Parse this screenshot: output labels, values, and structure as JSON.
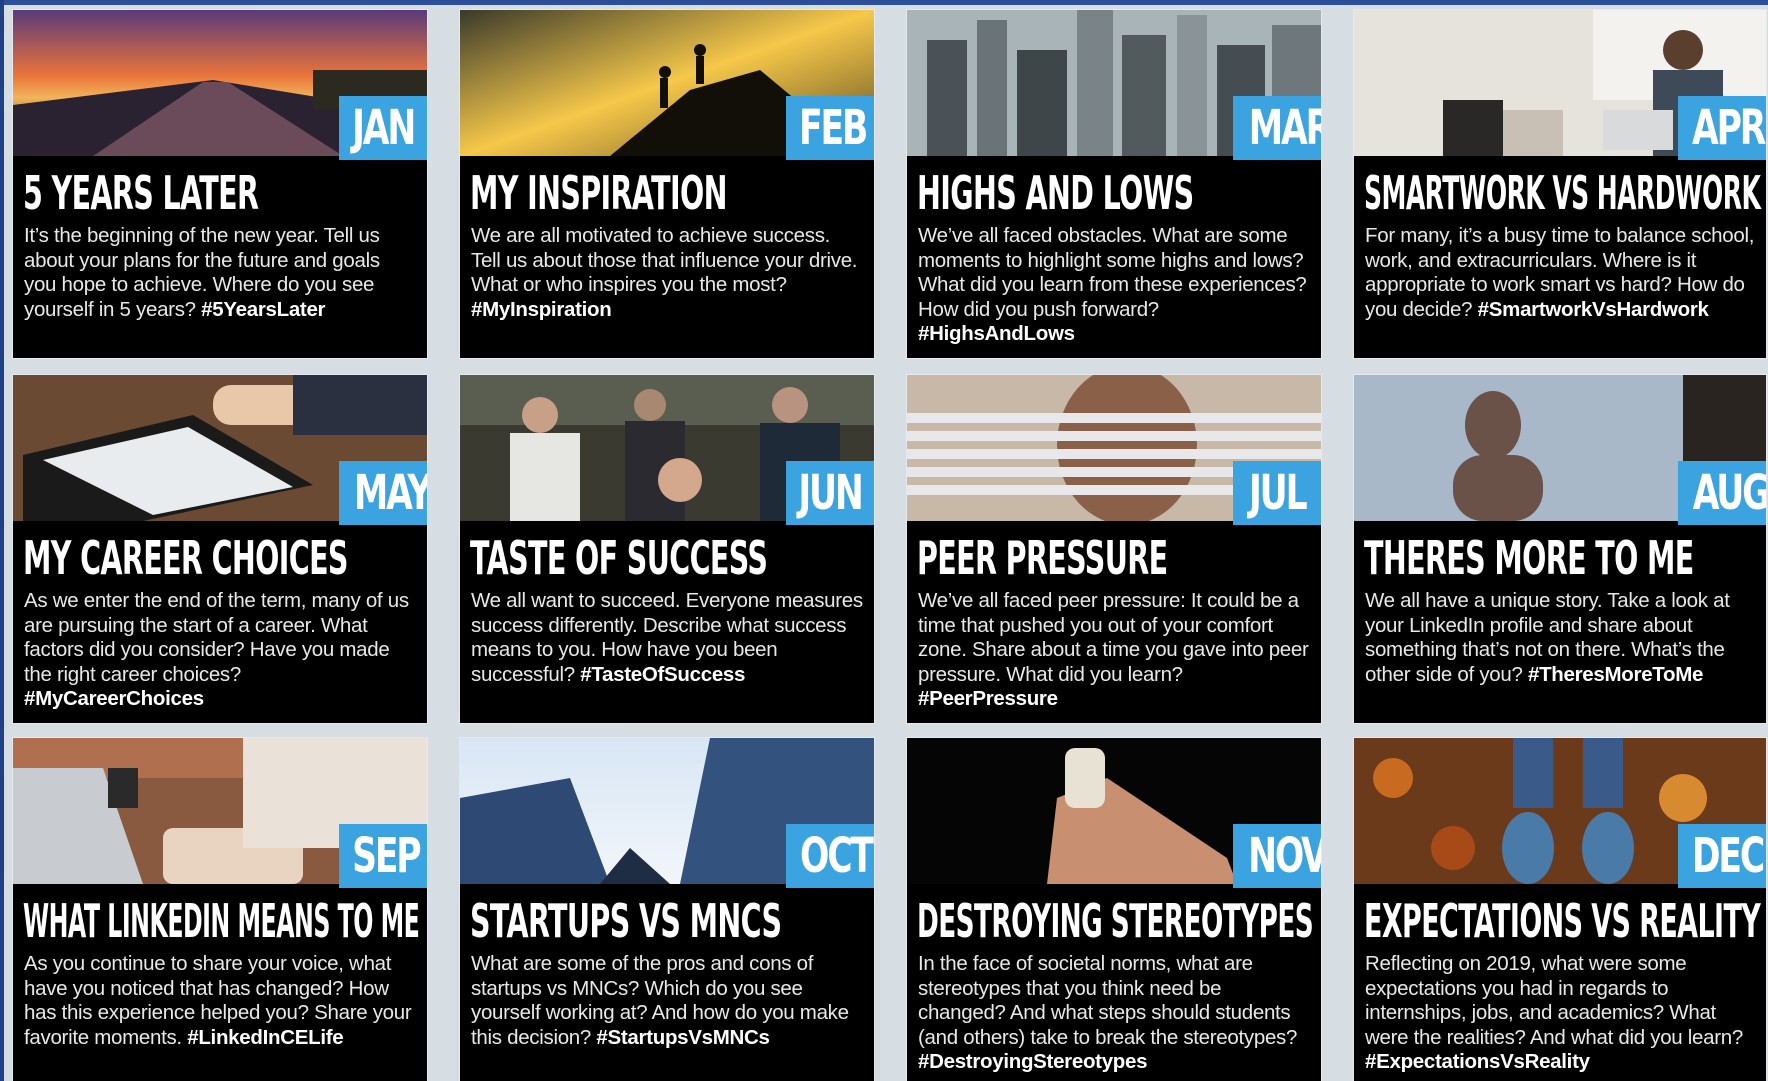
{
  "cards": [
    {
      "month": "JAN",
      "title": "5 YEARS LATER",
      "body": "It’s the beginning of the new year. Tell us about your plans for the future and goals you hope to achieve. Where do you see yourself in 5 years?",
      "tag": "#5YearsLater",
      "photo": "sunset-road-photo"
    },
    {
      "month": "FEB",
      "title": "MY INSPIRATION",
      "body": "We are all motivated to achieve success. Tell us about those that influence your drive. What or who inspires you the most?",
      "tag": "#MyInspiration",
      "photo": "climbers-silhouette-photo"
    },
    {
      "month": "MAR",
      "title": "HIGHS AND LOWS",
      "body": "We’ve all faced obstacles. What are some moments to highlight some highs and lows? What did you learn from these experiences? How did you push forward?",
      "tag": "#HighsAndLows",
      "photo": "city-skyline-photo"
    },
    {
      "month": "APR",
      "title": "SMARTWORK VS HARDWORK",
      "body": "For many, it’s a busy time to balance school, work, and extracurriculars. Where is it appropriate to work smart vs hard? How do you decide?",
      "tag": "#SmartworkVsHardwork",
      "photo": "man-at-laptop-photo"
    },
    {
      "month": "MAY",
      "title": "MY CAREER CHOICES",
      "body": "As we enter the end of the term, many of us are pursuing the start of a career. What factors did you consider? Have you made the right career choices?",
      "tag": "#MyCareerChoices",
      "photo": "tablet-signing-photo"
    },
    {
      "month": "JUN",
      "title": "TASTE OF SUCCESS",
      "body": "We all want to succeed. Everyone measures success differently. Describe what success means to you. How have you been successful?",
      "tag": "#TasteOfSuccess",
      "photo": "team-hands-photo"
    },
    {
      "month": "JUL",
      "title": "PEER PRESSURE",
      "body": "We’ve all faced peer pressure: It could be a time that pushed you out of your comfort zone. Share about a time you gave into peer pressure. What did you learn?",
      "tag": "#PeerPressure",
      "photo": "woman-through-blinds-photo"
    },
    {
      "month": "AUG",
      "title": "THERES MORE TO ME",
      "body": "We all have a unique story. Take a look at your LinkedIn profile and share about something that’s not on there. What’s the other side of you?",
      "tag": "#TheresMoreToMe",
      "photo": "shadow-silhouette-photo"
    },
    {
      "month": "SEP",
      "title": "WHAT LINKEDIN MEANS TO ME",
      "body": "As you continue to share your voice, what have you noticed that has changed? How has this experience helped you? Share your favorite moments.",
      "tag": "#LinkedInCELife",
      "photo": "laptop-desk-photo"
    },
    {
      "month": "OCT",
      "title": "STARTUPS VS MNCS",
      "body": "What are some of the pros and cons of startups vs MNCs? Which do you see yourself working at? And how do you make this decision?",
      "tag": "#StartupsVsMNCs",
      "photo": "glass-skyscrapers-photo"
    },
    {
      "month": "NOV",
      "title": "DESTROYING STEREOTYPES",
      "body": "In the face of societal norms, what are stereotypes that you think need be changed? And what steps should students (and others) take to break the stereotypes?",
      "tag": "#DestroyingStereotypes",
      "photo": "hand-crushing-cup-photo"
    },
    {
      "month": "DEC",
      "title": "EXPECTATIONS VS REALITY",
      "body": "Reflecting on 2019, what were some expectations you had in regards to internships, jobs, and academics? What were the realities? And what did you learn?",
      "tag": "#ExpectationsVsReality",
      "photo": "sneakers-autumn-leaves-photo"
    }
  ],
  "colors": {
    "month_badge": "#3ba3df",
    "card_bg": "#000000",
    "title_text": "#ffffff",
    "body_text": "#e8e8e8"
  }
}
